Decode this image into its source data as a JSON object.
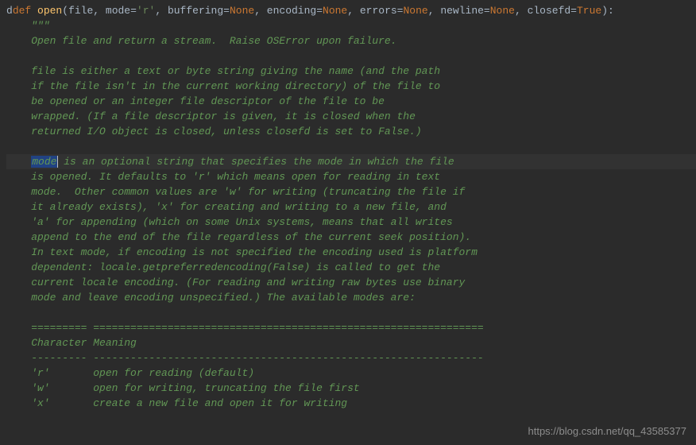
{
  "signature": {
    "def_kw": "def",
    "funcname": "open",
    "open_paren": "(",
    "params": [
      {
        "name": "file",
        "sep": ", "
      },
      {
        "name": "mode",
        "eq": "=",
        "value": "'r'",
        "value_type": "string",
        "sep": ", "
      },
      {
        "name": "buffering",
        "eq": "=",
        "value": "None",
        "value_type": "none",
        "sep": ", "
      },
      {
        "name": "encoding",
        "eq": "=",
        "value": "None",
        "value_type": "none",
        "sep": ", "
      },
      {
        "name": "errors",
        "eq": "=",
        "value": "None",
        "value_type": "none",
        "sep": ", "
      },
      {
        "name": "newline",
        "eq": "=",
        "value": "None",
        "value_type": "none",
        "sep": ", "
      },
      {
        "name": "closefd",
        "eq": "=",
        "value": "True",
        "value_type": "bool",
        "sep": ""
      }
    ],
    "close_paren": "):",
    "gutter_char": "d"
  },
  "doc": {
    "triple_quote": "\"\"\"",
    "indent": "    ",
    "lines": [
      "Open file and return a stream.  Raise OSError upon failure.",
      "",
      "file is either a text or byte string giving the name (and the path",
      "if the file isn't in the current working directory) of the file to",
      "be opened or an integer file descriptor of the file to be",
      "wrapped. (If a file descriptor is given, it is closed when the",
      "returned I/O object is closed, unless closefd is set to False.)",
      "",
      "is an optional string that specifies the mode in which the file",
      "is opened. It defaults to 'r' which means open for reading in text",
      "mode.  Other common values are 'w' for writing (truncating the file if",
      "it already exists), 'x' for creating and writing to a new file, and",
      "'a' for appending (which on some Unix systems, means that all writes",
      "append to the end of the file regardless of the current seek position).",
      "In text mode, if encoding is not specified the encoding used is platform",
      "dependent: locale.getpreferredencoding(False) is called to get the",
      "current locale encoding. (For reading and writing raw bytes use binary",
      "mode and leave encoding unspecified.) The available modes are:",
      "",
      "========= ===============================================================",
      "Character Meaning",
      "--------- ---------------------------------------------------------------",
      "'r'       open for reading (default)",
      "'w'       open for writing, truncating the file first",
      "'x'       create a new file and open it for writing"
    ],
    "highlighted_word": "mode",
    "highlighted_line_index": 8
  },
  "watermark": "https://blog.csdn.net/qq_43585377"
}
